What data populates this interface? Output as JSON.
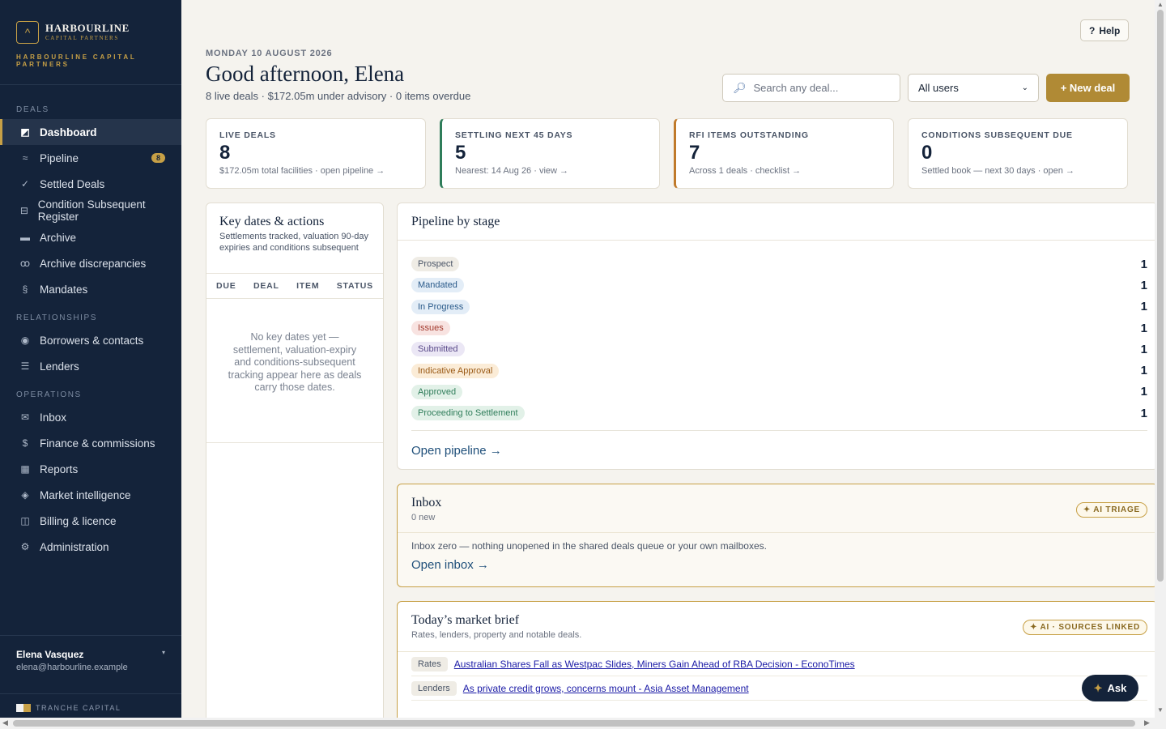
{
  "brand": {
    "name": "HARBOURLINE",
    "sub": "CAPITAL PARTNERS",
    "tagline": "HARBOURLINE CAPITAL PARTNERS"
  },
  "nav": {
    "sections": {
      "deals": "DEALS",
      "relationships": "RELATIONSHIPS",
      "operations": "OPERATIONS"
    },
    "items": {
      "dashboard": "Dashboard",
      "pipeline": "Pipeline",
      "pipeline_badge": "8",
      "settled": "Settled Deals",
      "condition": "Condition Subsequent Register",
      "archive": "Archive",
      "archive_disc": "Archive discrepancies",
      "mandates": "Mandates",
      "borrowers": "Borrowers & contacts",
      "lenders": "Lenders",
      "inbox": "Inbox",
      "finance": "Finance & commissions",
      "reports": "Reports",
      "market": "Market intelligence",
      "billing": "Billing & licence",
      "admin": "Administration"
    }
  },
  "user": {
    "name": "Elena Vasquez",
    "email": "elena@harbourline.example"
  },
  "footer_brand": "TRANCHE CAPITAL",
  "header": {
    "help": "Help",
    "date": "MONDAY 10 AUGUST 2026",
    "greeting": "Good afternoon, Elena",
    "summary": "8 live deals · $172.05m under advisory · 0 items overdue",
    "search_placeholder": "Search any deal...",
    "user_filter": "All users",
    "new_deal": "+ New deal"
  },
  "kpis": [
    {
      "label": "LIVE DEALS",
      "value": "8",
      "sub": "$172.05m total facilities · open pipeline →"
    },
    {
      "label": "SETTLING NEXT 45 DAYS",
      "value": "5",
      "sub": "Nearest: 14 Aug 26 · view →"
    },
    {
      "label": "RFI ITEMS OUTSTANDING",
      "value": "7",
      "sub": "Across 1 deals · checklist →"
    },
    {
      "label": "CONDITIONS SUBSEQUENT DUE",
      "value": "0",
      "sub": "Settled book — next 30 days · open →"
    }
  ],
  "key_dates": {
    "title": "Key dates & actions",
    "desc": "Settlements tracked, valuation 90-day expiries and conditions subsequent",
    "cols": [
      "DUE",
      "DEAL",
      "ITEM",
      "STATUS"
    ],
    "empty": "No key dates yet — settlement, valuation-expiry and conditions-subsequent tracking appear here as deals carry those dates."
  },
  "pipeline": {
    "title": "Pipeline by stage",
    "stages": [
      {
        "name": "Prospect",
        "count": "1",
        "bg": "#efece5",
        "fg": "#4a5567"
      },
      {
        "name": "Mandated",
        "count": "1",
        "bg": "#e3edf7",
        "fg": "#2a5a8a"
      },
      {
        "name": "In Progress",
        "count": "1",
        "bg": "#e3edf7",
        "fg": "#2a5a8a"
      },
      {
        "name": "Issues",
        "count": "1",
        "bg": "#f8e3e1",
        "fg": "#a33a2e"
      },
      {
        "name": "Submitted",
        "count": "1",
        "bg": "#ebe7f5",
        "fg": "#5a4a8a"
      },
      {
        "name": "Indicative Approval",
        "count": "1",
        "bg": "#fbecd7",
        "fg": "#9a5a16"
      },
      {
        "name": "Approved",
        "count": "1",
        "bg": "#e2f1e8",
        "fg": "#2f7d5a"
      },
      {
        "name": "Proceeding to Settlement",
        "count": "1",
        "bg": "#e2f1e8",
        "fg": "#2f7d5a"
      }
    ],
    "open_link": "Open pipeline →"
  },
  "inbox": {
    "title": "Inbox",
    "sub": "0 new",
    "tag": "✦ AI TRIAGE",
    "message": "Inbox zero — nothing unopened in the shared deals queue or your own mailboxes.",
    "open_link": "Open inbox →"
  },
  "brief": {
    "title": "Today’s market brief",
    "sub": "Rates, lenders, property and notable deals.",
    "tag": "✦ AI · SOURCES LINKED",
    "items": [
      {
        "tag": "Rates",
        "text": "Australian Shares Fall as Westpac Slides, Miners Gain Ahead of RBA Decision - EconoTimes"
      },
      {
        "tag": "Lenders",
        "text": "As private credit grows, concerns mount - Asia Asset Management"
      }
    ]
  },
  "ask": "Ask"
}
